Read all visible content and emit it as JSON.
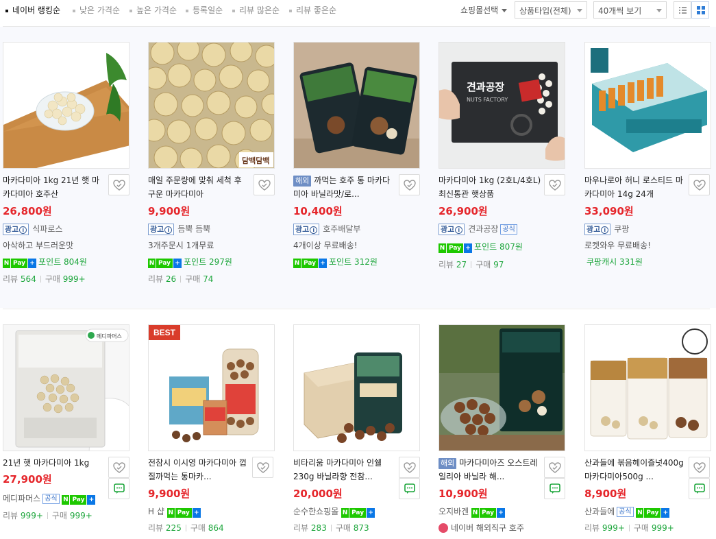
{
  "sort": {
    "options": [
      "네이버 랭킹순",
      "낮은 가격순",
      "높은 가격순",
      "등록일순",
      "리뷰 많은순",
      "리뷰 좋은순"
    ],
    "active_index": 0
  },
  "filters": {
    "mall_select": "쇼핑몰선택",
    "product_type": "상품타입(전체)",
    "page_size": "40개씩 보기",
    "view_list_icon": "list-view-icon",
    "view_grid_icon": "grid-view-icon",
    "active_view": "grid"
  },
  "colors": {
    "price": "#e5262b",
    "green": "#1ba53a",
    "accent": "#2e7cd6",
    "row_bg": "#f8f9fd"
  },
  "products": [
    {
      "title": "마카다미아 1kg 21년 햇 마카다미아 호주산",
      "overseas": "",
      "price": "26,800원",
      "ad": "광고",
      "store": "식파로스",
      "official": "",
      "line1": "아삭하고 부드러운맛",
      "point": "포인트 804원",
      "review_label": "리뷰",
      "review": "564",
      "buy_label": "구매",
      "buy": "999+"
    },
    {
      "title": "매일 주문량에 맞춰 세척 후 구운 마카다미아",
      "overseas": "",
      "price": "9,900원",
      "ad": "광고",
      "store": "듬뿍 듬뿍",
      "official": "",
      "line1": "3개주문시 1개무료",
      "point": "포인트 297원",
      "review_label": "리뷰",
      "review": "26",
      "buy_label": "구매",
      "buy": "74",
      "brand_mark": "담백담백"
    },
    {
      "title": "까먹는 호주 통 마카다미아 바닐라맛/로...",
      "overseas": "해외",
      "price": "10,400원",
      "ad": "광고",
      "store": "호주배달부",
      "official": "",
      "line1": "4개이상 무료배송!",
      "point": "포인트 312원",
      "review_label": "",
      "review": "",
      "buy_label": "",
      "buy": ""
    },
    {
      "title": "마카다미아 1kg (2호L/4호L) 최신통관 햇상품",
      "overseas": "",
      "price": "26,900원",
      "ad": "광고",
      "store": "견과공장",
      "official": "공식",
      "line1": "",
      "point": "포인트 807원",
      "review_label": "리뷰",
      "review": "27",
      "buy_label": "구매",
      "buy": "97",
      "brand_mark": "견과공장",
      "brand_sub": "NUTS FACTORY"
    },
    {
      "title": "마우나로아 허니 로스티드 마카다미아 14g 24개",
      "overseas": "",
      "price": "33,090원",
      "ad": "광고",
      "store": "쿠팡",
      "official": "",
      "line1": "로켓와우 무료배송!",
      "point": "쿠팡캐시 331원",
      "review_label": "",
      "review": "",
      "buy_label": "",
      "buy": ""
    },
    {
      "title": "21년 햇 마카다미아 1kg",
      "overseas": "",
      "price": "27,900원",
      "ad": "",
      "store": "메디파머스",
      "official": "공식",
      "line1": "",
      "point": "",
      "review_label": "리뷰",
      "review": "999+",
      "buy_label": "구매",
      "buy": "999+",
      "brand_mark": "메디파머스"
    },
    {
      "title": "전참시 이시영 마카다미아 껍질까먹는 통마카...",
      "overseas": "",
      "price": "9,900원",
      "ad": "",
      "store": "H 샵",
      "official": "",
      "line1": "",
      "point": "",
      "review_label": "리뷰",
      "review": "225",
      "buy_label": "구매",
      "buy": "864",
      "badge": "BEST"
    },
    {
      "title": "비타리움 마카다미아 인쉘 230g 바닐라향 전참...",
      "overseas": "",
      "price": "20,000원",
      "ad": "",
      "store": "순수한쇼핑몰",
      "official": "",
      "line1": "",
      "point": "",
      "review_label": "리뷰",
      "review": "283",
      "buy_label": "구매",
      "buy": "873"
    },
    {
      "title": "마카다미아즈 오스트레일리아 바닐라 해...",
      "overseas": "해외",
      "price": "10,900원",
      "ad": "",
      "store": "오지바겐",
      "official": "",
      "line1": "",
      "point": "",
      "review_label": "",
      "review": "",
      "buy_label": "",
      "buy": "",
      "extra": "네이버 해외직구 호주"
    },
    {
      "title": "산과들에 볶음헤이즐넛400g 마카다미아500g ...",
      "overseas": "",
      "price": "8,900원",
      "ad": "",
      "store": "산과들에",
      "official": "공식",
      "line1": "",
      "point": "",
      "review_label": "리뷰",
      "review": "999+",
      "buy_label": "구매",
      "buy": "999+"
    }
  ],
  "npay": {
    "n": "N",
    "pay": "Pay",
    "plus": "+"
  },
  "ad_info_glyph": "i"
}
